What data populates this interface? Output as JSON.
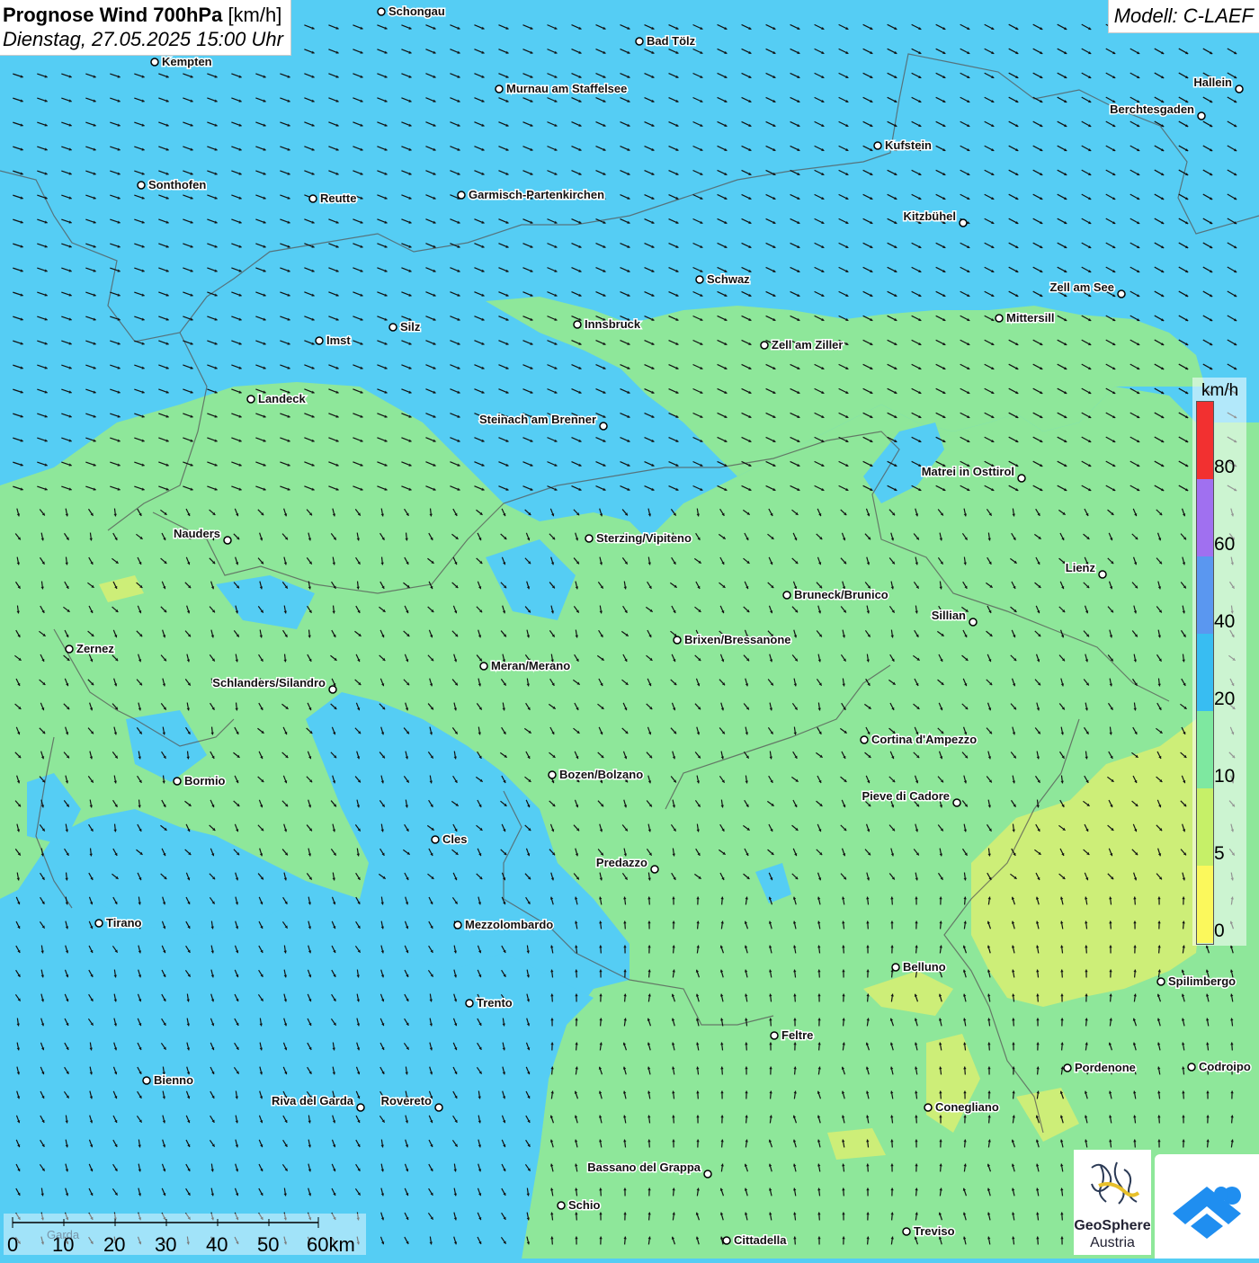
{
  "title": {
    "main": "Prognose Wind 700hPa",
    "unit": "[km/h]",
    "datetime": "Dienstag, 27.05.2025 15:00 Uhr"
  },
  "model_label": "Modell: C-LAEF",
  "legend": {
    "unit": "km/h",
    "labels": [
      "80",
      "60",
      "40",
      "20",
      "10",
      "5",
      "0"
    ],
    "colors": [
      "#f23030",
      "#a070f0",
      "#5a97f0",
      "#38bdf2",
      "#7ee8a0",
      "#c6f068",
      "#fbf85c"
    ]
  },
  "scale_bar": {
    "labels": [
      "0",
      "10",
      "20",
      "30",
      "40",
      "50",
      "60km"
    ],
    "faint_label": "Garda"
  },
  "colors": {
    "wind_blue": "#55cdf4",
    "wind_green": "#8ee79a",
    "wind_yellow": "#cdee78",
    "arrow": "#111111"
  },
  "logos": {
    "geosphere_line1": "GeoSphere",
    "geosphere_line2": "Austria"
  },
  "cities": [
    {
      "name": "Schongau"
    },
    {
      "name": "Bad Tölz"
    },
    {
      "name": "Kempten"
    },
    {
      "name": "Murnau am Staffelsee"
    },
    {
      "name": "Hallein"
    },
    {
      "name": "Berchtesgaden"
    },
    {
      "name": "Kufstein"
    },
    {
      "name": "Sonthofen"
    },
    {
      "name": "Reutte"
    },
    {
      "name": "Garmisch-Partenkirchen"
    },
    {
      "name": "Kitzbühel"
    },
    {
      "name": "Schwaz"
    },
    {
      "name": "Zell am See"
    },
    {
      "name": "Innsbruck"
    },
    {
      "name": "Mittersill"
    },
    {
      "name": "Silz"
    },
    {
      "name": "Imst"
    },
    {
      "name": "Zell am Ziller"
    },
    {
      "name": "Landeck"
    },
    {
      "name": "Steinach am Brenner"
    },
    {
      "name": "Matrei in Osttirol"
    },
    {
      "name": "Nauders"
    },
    {
      "name": "Sterzing/Vipiteno"
    },
    {
      "name": "Lienz"
    },
    {
      "name": "Bruneck/Brunico"
    },
    {
      "name": "Sillian"
    },
    {
      "name": "Brixen/Bressanone"
    },
    {
      "name": "Zernez"
    },
    {
      "name": "Meran/Merano"
    },
    {
      "name": "Schlanders/Silandro"
    },
    {
      "name": "Cortina d'Ampezzo"
    },
    {
      "name": "Bozen/Bolzano"
    },
    {
      "name": "Bormio"
    },
    {
      "name": "Pieve di Cadore"
    },
    {
      "name": "Cles"
    },
    {
      "name": "Predazzo"
    },
    {
      "name": "Tirano"
    },
    {
      "name": "Mezzolombardo"
    },
    {
      "name": "Belluno"
    },
    {
      "name": "Spilimbergo"
    },
    {
      "name": "Trento"
    },
    {
      "name": "Feltre"
    },
    {
      "name": "Bienno"
    },
    {
      "name": "Pordenone"
    },
    {
      "name": "Codroipo"
    },
    {
      "name": "Riva del Garda"
    },
    {
      "name": "Rovereto"
    },
    {
      "name": "Conegliano"
    },
    {
      "name": "Bassano del Grappa"
    },
    {
      "name": "Schio"
    },
    {
      "name": "Treviso"
    },
    {
      "name": "Cittadella"
    }
  ]
}
